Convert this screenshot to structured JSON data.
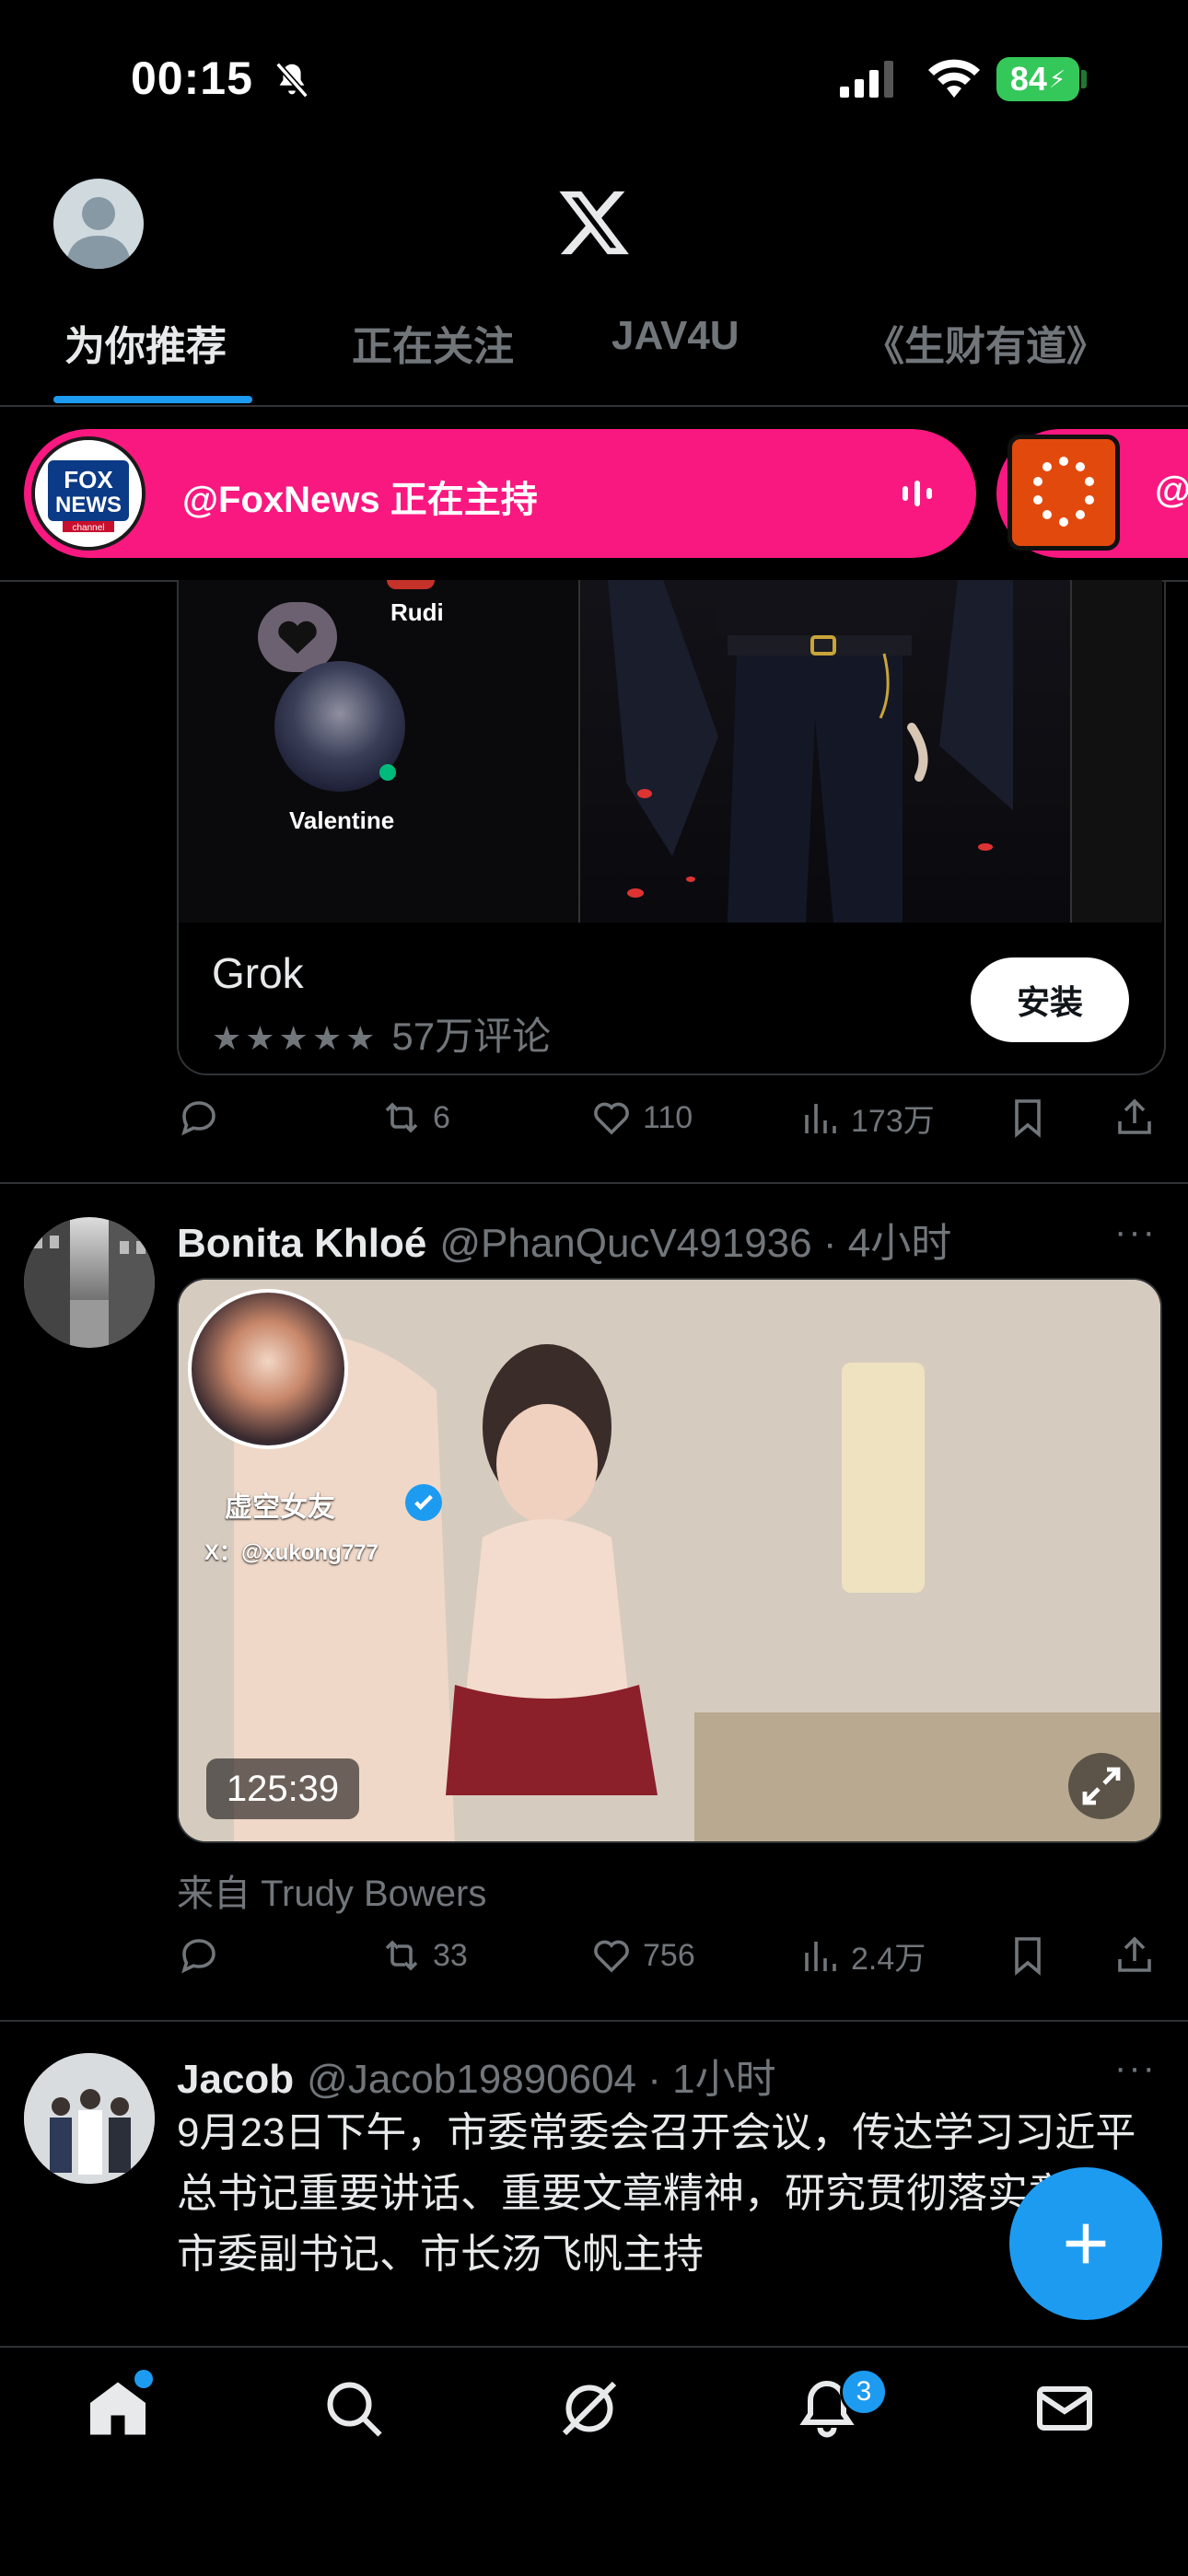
{
  "status_bar": {
    "time": "00:15",
    "battery": "84"
  },
  "tabs": [
    {
      "label": "为你推荐",
      "active": true
    },
    {
      "label": "正在关注",
      "active": false
    },
    {
      "label": "JAV4U",
      "active": false
    },
    {
      "label": "《生财有道》",
      "active": false
    }
  ],
  "spaces": {
    "host_text": "@FoxNews 正在主持",
    "logo_line1": "FOX",
    "logo_line2": "NEWS",
    "logo_line3": "channel",
    "second_at": "@"
  },
  "ad_card": {
    "char1": "Rudi",
    "char2": "Valentine",
    "app_name": "Grok",
    "stars": "★★★★★",
    "reviews": "57万评论",
    "install_label": "安装",
    "replies": "",
    "reposts": "6",
    "likes": "110",
    "views": "173万"
  },
  "post1": {
    "name": "Bonita Khloé",
    "handle": "@PhanQucV491936 · 4小时",
    "more": "···",
    "watermark_name": "虚空女友",
    "watermark_handle": "X：@xukong777",
    "video_duration": "125:39",
    "from_text": "来自 Trudy Bowers",
    "reposts": "33",
    "likes": "756",
    "views": "2.4万"
  },
  "post2": {
    "name": "Jacob",
    "handle": "@Jacob19890604 · 1小时",
    "more": "···",
    "text": "9月23日下午，市委常委会召开会议，传达学习习近平总书记重要讲话、重要文章精神，研究贯彻落实意见。市委副书记、市长汤飞帆主持"
  },
  "nav": {
    "notifications_badge": "3"
  },
  "colors": {
    "accent": "#1d9bf0",
    "spaces_pink": "#f91880",
    "battery": "#34c759"
  }
}
